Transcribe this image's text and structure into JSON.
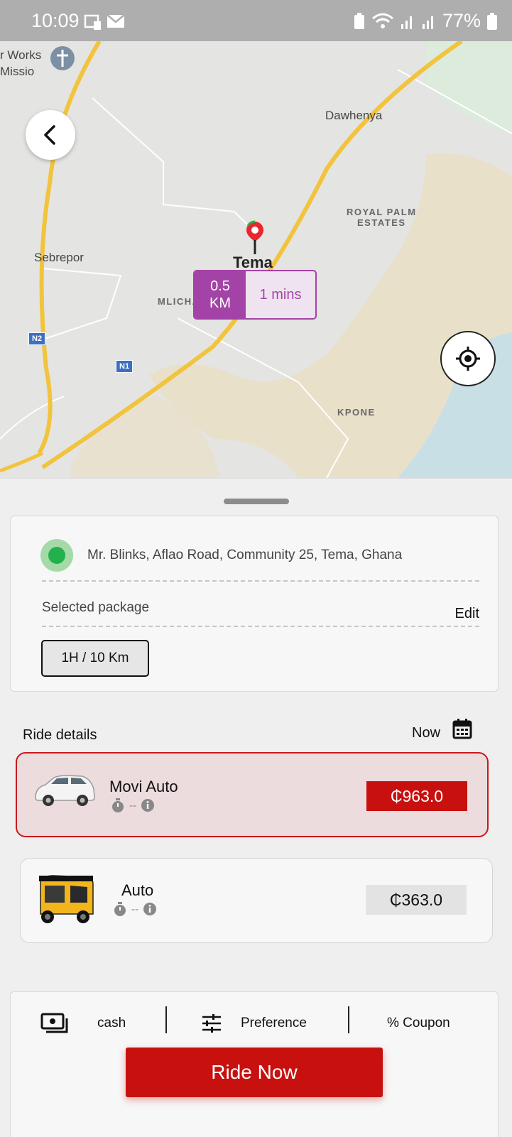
{
  "status_bar": {
    "time": "10:09",
    "battery": "77%"
  },
  "map": {
    "labels": {
      "works": "r Works",
      "missio": "Missio",
      "dawhenya": "Dawhenya",
      "sebrepor": "Sebrepor",
      "royal_palm": "ROYAL PALM",
      "estates": "ESTATES",
      "mlichakpo": "MLICHAKPO",
      "kpone": "KPONE",
      "n2": "N2",
      "n1": "N1"
    },
    "pin_label": "Tema",
    "eta": {
      "distance_value": "0.5",
      "distance_unit": "KM",
      "time": "1 mins"
    },
    "colors": {
      "route": "#f2c33c",
      "accent": "#a443a7",
      "sand": "#e9e0ca",
      "water": "#c8dfe5"
    }
  },
  "pickup": {
    "address": "Mr. Blinks, Aflao Road, Community 25, Tema, Ghana",
    "package_label": "Selected package",
    "edit_label": "Edit",
    "package_value": "1H / 10 Km"
  },
  "ride_details": {
    "title": "Ride details",
    "schedule_label": "Now",
    "options": [
      {
        "name": "Movi Auto",
        "eta": "--",
        "price": "₵963.0",
        "vehicle_icon": "car-icon",
        "selected": true
      },
      {
        "name": "Auto",
        "eta": "--",
        "price": "₵363.0",
        "vehicle_icon": "auto-rickshaw-icon",
        "selected": false
      }
    ]
  },
  "footer": {
    "payment_label": "cash",
    "preference_label": "Preference",
    "coupon_label": "% Coupon",
    "ride_now_label": "Ride Now"
  },
  "colors": {
    "brand_red": "#c8110e",
    "pickup_green": "#22b14c"
  }
}
